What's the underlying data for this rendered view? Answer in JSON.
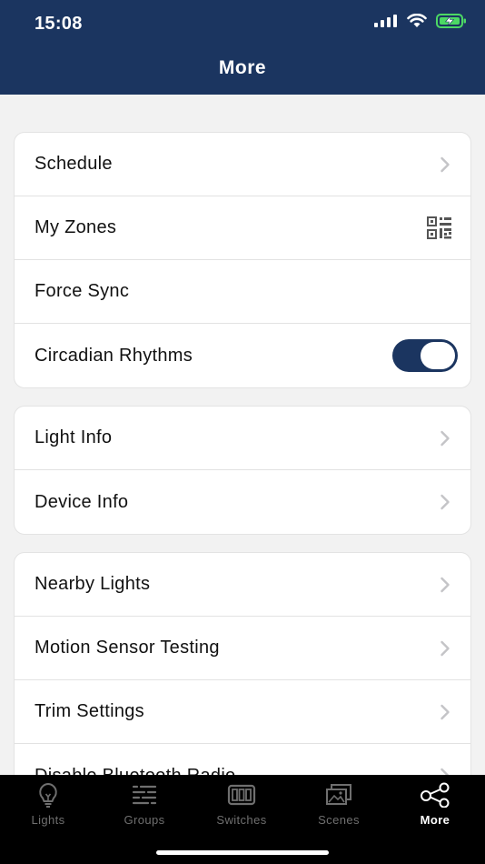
{
  "status_bar": {
    "time": "15:08"
  },
  "header": {
    "title": "More"
  },
  "sections": [
    {
      "items": [
        {
          "label": "Schedule",
          "accessory": "chevron-icon"
        },
        {
          "label": "My Zones",
          "accessory": "qr-code-icon"
        },
        {
          "label": "Force Sync",
          "accessory": "none"
        },
        {
          "label": "Circadian Rhythms",
          "accessory": "toggle",
          "toggle_on": true
        }
      ]
    },
    {
      "items": [
        {
          "label": "Light Info",
          "accessory": "chevron-icon"
        },
        {
          "label": "Device Info",
          "accessory": "chevron-icon"
        }
      ]
    },
    {
      "items": [
        {
          "label": "Nearby Lights",
          "accessory": "chevron-icon"
        },
        {
          "label": "Motion Sensor Testing",
          "accessory": "chevron-icon"
        },
        {
          "label": "Trim Settings",
          "accessory": "chevron-icon"
        },
        {
          "label": "Disable Bluetooth Radio",
          "accessory": "chevron-icon"
        }
      ]
    }
  ],
  "tabbar": {
    "tabs": [
      {
        "label": "Lights",
        "icon": "lightbulb-icon"
      },
      {
        "label": "Groups",
        "icon": "groups-icon"
      },
      {
        "label": "Switches",
        "icon": "switches-icon"
      },
      {
        "label": "Scenes",
        "icon": "scenes-icon"
      },
      {
        "label": "More",
        "icon": "share-nodes-icon",
        "active": true
      }
    ]
  },
  "colors": {
    "header_bg": "#1b3560",
    "toggle_on": "#1b3560",
    "tabbar_bg": "#000000",
    "battery_charge": "#4cd964"
  }
}
